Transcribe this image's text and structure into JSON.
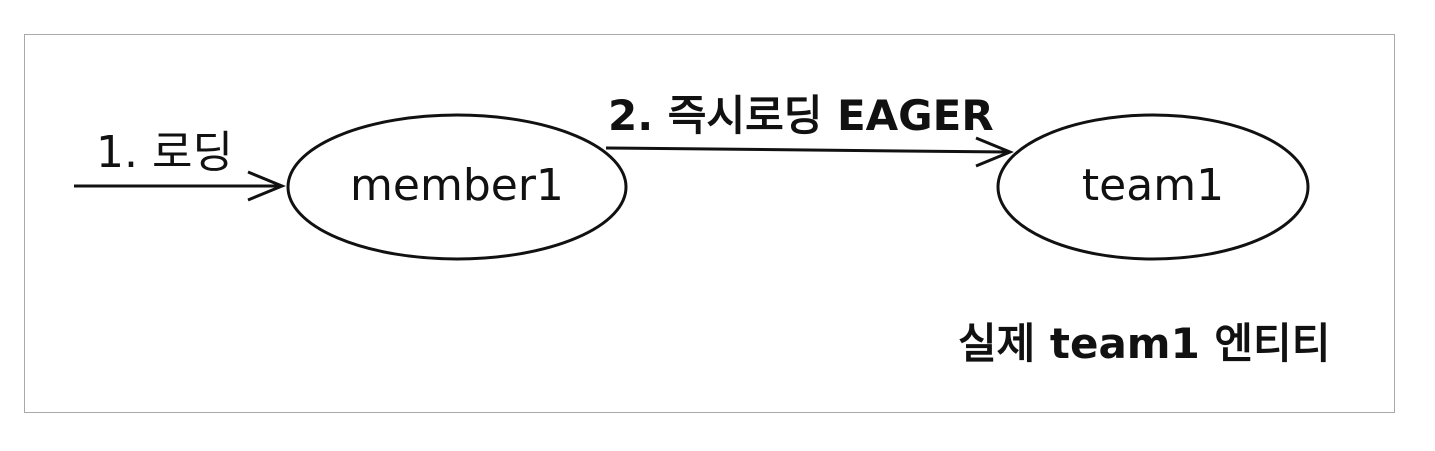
{
  "diagram": {
    "step1_label": "1. 로딩",
    "step2_label": "2. 즉시로딩 EAGER",
    "nodes": {
      "member": "member1",
      "team": "team1"
    },
    "caption": "실제 team1 엔티티"
  },
  "colors": {
    "stroke": "#111111",
    "frame": "#a9a9a9",
    "background": "#ffffff"
  }
}
